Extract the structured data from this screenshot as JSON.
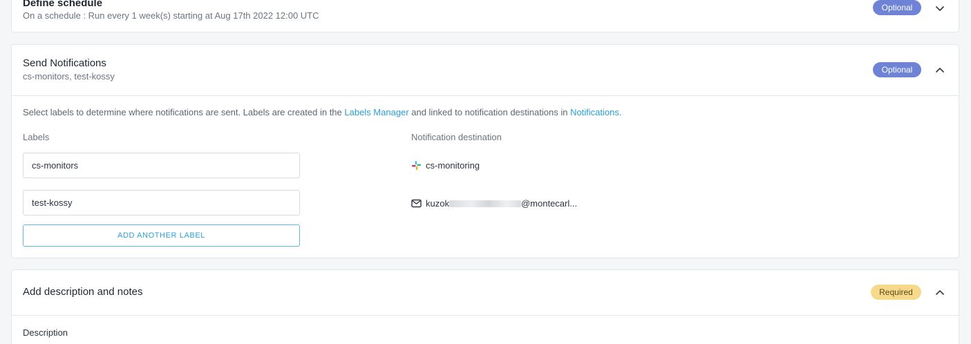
{
  "schedule": {
    "title": "Define schedule",
    "subtitle": "On a schedule : Run every 1 week(s) starting at Aug 17th 2022 12:00 UTC",
    "badge": "Optional"
  },
  "notifications": {
    "title": "Send Notifications",
    "subtitle": "cs-monitors, test-kossy",
    "badge": "Optional",
    "info_prefix": "Select labels to determine where notifications are sent. Labels are created in the ",
    "labels_manager_link": "Labels Manager",
    "info_middle": " and linked to notification destinations in ",
    "notifications_link": "Notifications.",
    "labels_header": "Labels",
    "destination_header": "Notification destination",
    "rows": [
      {
        "label": "cs-monitors",
        "destination": "cs-monitoring",
        "icon": "slack-icon"
      },
      {
        "label": "test-kossy",
        "destination_prefix": "kuzok",
        "destination_suffix": "@montecarl...",
        "icon": "mail-icon"
      }
    ],
    "add_label_button": "ADD ANOTHER LABEL"
  },
  "description": {
    "title": "Add description and notes",
    "badge": "Required",
    "field_label": "Description"
  },
  "colors": {
    "optional_badge": "#6f83d6",
    "required_badge": "#f6d98a",
    "link": "#2a9fd6"
  }
}
